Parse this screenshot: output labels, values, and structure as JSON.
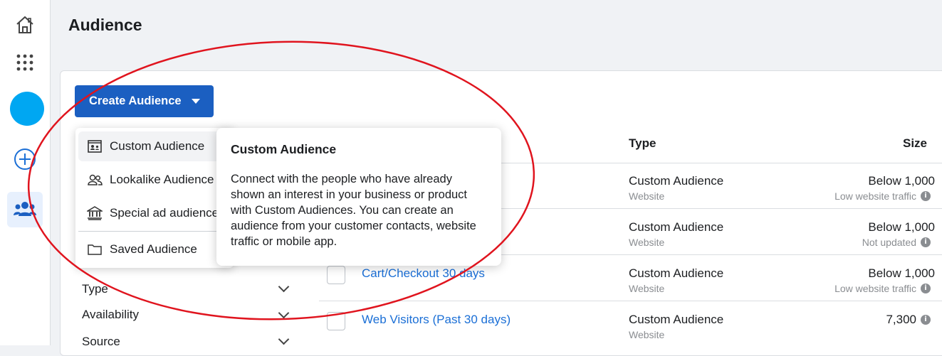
{
  "page": {
    "title": "Audience"
  },
  "rail": {
    "icons": [
      "home-icon",
      "apps-grid-icon",
      "profile-avatar",
      "create-plus-icon",
      "audiences-people-icon"
    ],
    "avatar_color": "#00a7f2",
    "accent": "#1b5fc1"
  },
  "toolbar": {
    "create_label": "Create Audience"
  },
  "dropdown": {
    "items": [
      {
        "label": "Custom Audience",
        "icon": "custom-audience-icon"
      },
      {
        "label": "Lookalike Audience",
        "icon": "lookalike-people-icon"
      },
      {
        "label": "Special ad audience",
        "icon": "bank-building-icon"
      },
      {
        "label": "Saved Audience",
        "icon": "folder-icon"
      }
    ]
  },
  "tooltip": {
    "title": "Custom Audience",
    "body": "Connect with the people who have already shown an interest in your business or product with Custom Audiences. You can create an audience from your customer contacts, website traffic or mobile app."
  },
  "table": {
    "columns": {
      "type": "Type",
      "size": "Size"
    },
    "rows": [
      {
        "name": "",
        "type": "Custom Audience",
        "source": "Website",
        "size": "Below 1,000",
        "status": "Low website traffic"
      },
      {
        "name": "",
        "type": "Custom Audience",
        "source": "Website",
        "size": "Below 1,000",
        "status": "Not updated"
      },
      {
        "name": "Cart/Checkout 30 days",
        "type": "Custom Audience",
        "source": "Website",
        "size": "Below 1,000",
        "status": "Low website traffic"
      },
      {
        "name": "Web Visitors (Past 30 days)",
        "type": "Custom Audience",
        "source": "Website",
        "size": "7,300",
        "status": ""
      }
    ]
  },
  "filters": [
    {
      "label": "Type"
    },
    {
      "label": "Availability"
    },
    {
      "label": "Source"
    }
  ],
  "annotation_color": "#e0141e"
}
